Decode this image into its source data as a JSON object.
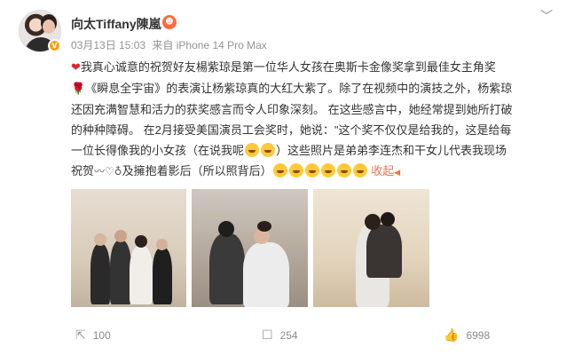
{
  "post": {
    "username": "向太Tiffany陳嵐",
    "date": "03月13日 15:03",
    "source": "来自 iPhone 14 Pro Max",
    "line1": "我真心诚意的祝贺好友楊紫琼是第一位华人女孩在奥斯卡金像奖拿到最佳女主角奖",
    "line2": "《瞬息全宇宙》的表演让杨紫琼真的大红大紫了。除了在视频中的演技之外，杨紫琼",
    "line3": "还因充满智慧和活力的获奖感言而令人印象深刻。 在这些感言中，她经常提到她所打破",
    "line4": "的种种障碍。 在2月接受美国演员工会奖时，她说：\"这个奖不仅仅是给我的，这是给每",
    "line5a": "一位长得像我的小女孩（在说我呢",
    "line5b": "）这些照片是弟弟李连杰和干女儿代表我现场",
    "line6a": "祝贺",
    "line6b": "及擁抱着影后（所以照背后）",
    "collapse": "收起",
    "collapse_arrow": "◀"
  },
  "actions": {
    "forward_count": "100",
    "comment_count": "254",
    "like_count": "6998"
  },
  "icons": {
    "vip_badge": "V",
    "member": "☻",
    "more": "﹀",
    "heart": "❤",
    "rose": "🌹",
    "forward": "⇱",
    "comment": "☐",
    "like": "👍",
    "party": "〰",
    "heart_small": "♡",
    "balloon": "♁"
  }
}
